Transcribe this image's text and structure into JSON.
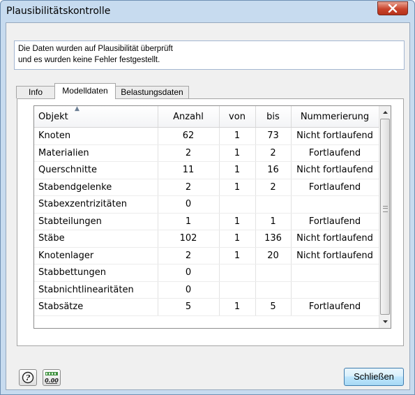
{
  "window": {
    "title": "Plausibilitätskontrolle"
  },
  "info": {
    "line1": "Die Daten wurden auf Plausibilität überprüft",
    "line2": "und es wurden keine Fehler festgestellt."
  },
  "tabs": [
    {
      "label": "Info"
    },
    {
      "label": "Modelldaten"
    },
    {
      "label": "Belastungsdaten"
    }
  ],
  "active_tab": "Modelldaten",
  "table": {
    "columns": [
      "Objekt",
      "Anzahl",
      "von",
      "bis",
      "Nummerierung"
    ],
    "rows": [
      {
        "objekt": "Knoten",
        "anzahl": "62",
        "von": "1",
        "bis": "73",
        "nummerierung": "Nicht fortlaufend"
      },
      {
        "objekt": "Materialien",
        "anzahl": "2",
        "von": "1",
        "bis": "2",
        "nummerierung": "Fortlaufend"
      },
      {
        "objekt": "Querschnitte",
        "anzahl": "11",
        "von": "1",
        "bis": "16",
        "nummerierung": "Nicht fortlaufend"
      },
      {
        "objekt": "Stabendgelenke",
        "anzahl": "2",
        "von": "1",
        "bis": "2",
        "nummerierung": "Fortlaufend"
      },
      {
        "objekt": "Stabexzentrizitäten",
        "anzahl": "0",
        "von": "",
        "bis": "",
        "nummerierung": ""
      },
      {
        "objekt": "Stabteilungen",
        "anzahl": "1",
        "von": "1",
        "bis": "1",
        "nummerierung": "Fortlaufend"
      },
      {
        "objekt": "Stäbe",
        "anzahl": "102",
        "von": "1",
        "bis": "136",
        "nummerierung": "Nicht fortlaufend"
      },
      {
        "objekt": "Knotenlager",
        "anzahl": "2",
        "von": "1",
        "bis": "20",
        "nummerierung": "Nicht fortlaufend"
      },
      {
        "objekt": "Stabbettungen",
        "anzahl": "0",
        "von": "",
        "bis": "",
        "nummerierung": ""
      },
      {
        "objekt": "Stabnichtlinearitäten",
        "anzahl": "0",
        "von": "",
        "bis": "",
        "nummerierung": ""
      },
      {
        "objekt": "Stabsätze",
        "anzahl": "5",
        "von": "1",
        "bis": "5",
        "nummerierung": "Fortlaufend"
      }
    ]
  },
  "buttons": {
    "units_label": "0.00",
    "close_label": "Schließen"
  },
  "icons": {
    "close": "close-icon",
    "help": "help-icon",
    "units": "units-icon",
    "sort": "sort-ascending-icon"
  },
  "colors": {
    "titlebar": "#c7dbef",
    "close_button": "#c9442c",
    "info_border": "#a3b6d1",
    "primary_button": "#bee6fd"
  }
}
